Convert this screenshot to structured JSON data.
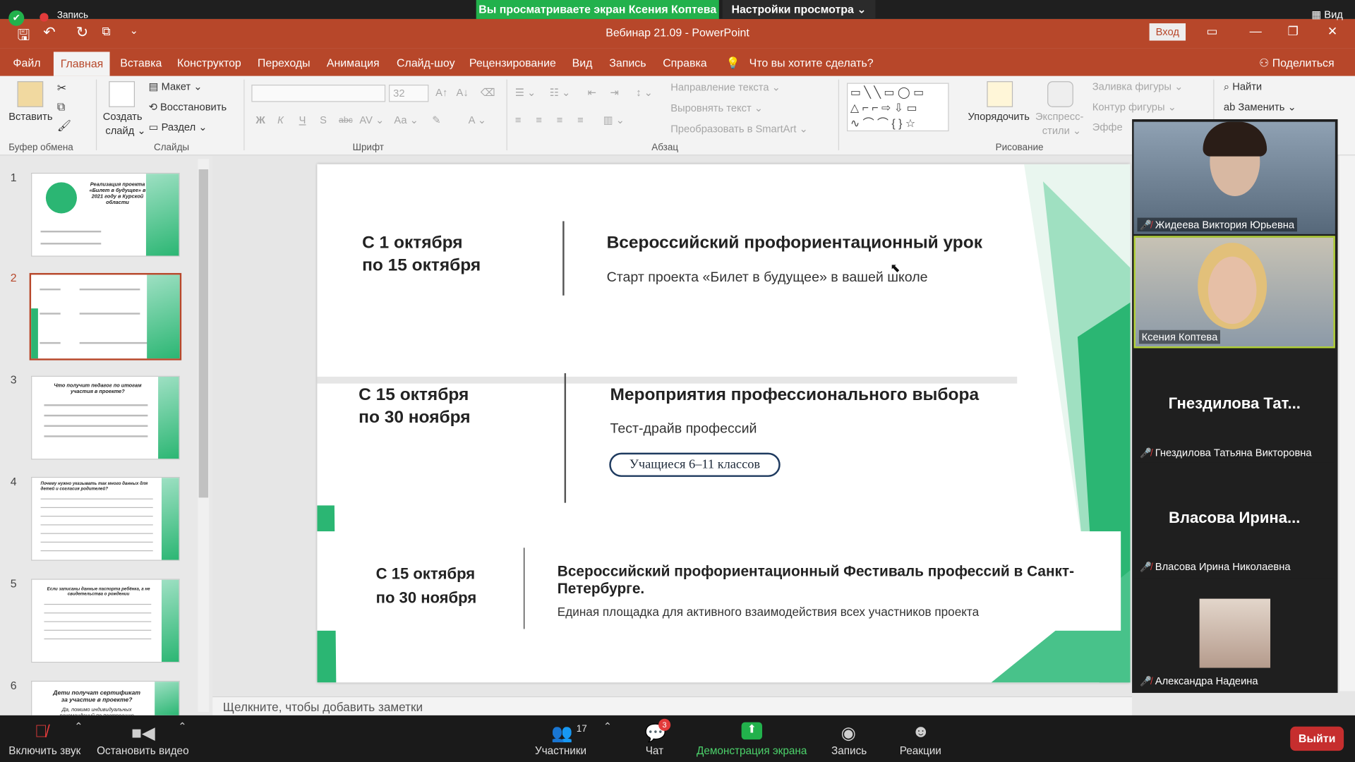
{
  "zoom_banner": {
    "sharing_text": "Вы просматриваете экран Ксения Коптева",
    "view_settings": "Настройки просмотра ⌄",
    "recording_label": "Запись",
    "view_label": "Вид"
  },
  "titlebar": {
    "document": "Вебинар 21.09  -  PowerPoint",
    "login": "Вход"
  },
  "menu": {
    "tabs": [
      "Файл",
      "Главная",
      "Вставка",
      "Конструктор",
      "Переходы",
      "Анимация",
      "Слайд-шоу",
      "Рецензирование",
      "Вид",
      "Запись",
      "Справка"
    ],
    "active_tab": "Главная",
    "tell_me": "Что вы хотите сделать?",
    "share": "Поделиться"
  },
  "ribbon": {
    "paste": "Вставить",
    "clipboard_group": "Буфер обмена",
    "new_slide_1": "Создать",
    "new_slide_2": "слайд ⌄",
    "layout": "Макет ⌄",
    "reset": "Восстановить",
    "section": "Раздел ⌄",
    "slides_group": "Слайды",
    "font_size": "32",
    "font_group": "Шрифт",
    "font_buttons": [
      "Ж",
      "К",
      "Ч",
      "S",
      "abc",
      "AV ⌄",
      "Аа ⌄",
      "A ⌄"
    ],
    "text_direction": "Направление текста ⌄",
    "align_text": "Выровнять текст ⌄",
    "smartart": "Преобразовать в SmartArt ⌄",
    "paragraph_group": "Абзац",
    "arrange": "Упорядочить",
    "express_styles_1": "Экспресс-",
    "express_styles_2": "стили ⌄",
    "shape_fill": "Заливка фигуры ⌄",
    "shape_outline": "Контур фигуры ⌄",
    "shape_effects": "Эффе",
    "drawing_group": "Рисование",
    "find": "Найти",
    "replace": "Заменить ⌄"
  },
  "thumbnails": {
    "numbers": [
      "1",
      "2",
      "3",
      "4",
      "5",
      "6"
    ],
    "selected": "2",
    "t1_title": "Реализация проекта «Билет в будущее» в 2021 году в Курской области",
    "t3_title": "Что получит педагог по итогам участия в проекте?",
    "t4_title": "Почему нужно указывать так много данных для детей и согласия родителей?",
    "t5_title": "Если записаны данные паспорта ребёнка, а не свидетельства о рождении",
    "t6_title": "Дети получат сертификат за участие в проекте?",
    "t6_body": "Да, помимо индивидуальных рекомендаций по построению"
  },
  "slide": {
    "row1": {
      "date_1": "С 1 октября",
      "date_2": "по 15 октября",
      "title": "Всероссийский профориентационный урок",
      "subtitle": "Старт проекта «Билет в будущее» в вашей школе"
    },
    "row2": {
      "date_1": "С 15 октября",
      "date_2": "по 30 ноября",
      "title": "Мероприятия профессионального выбора",
      "subtitle": "Тест-драйв профессий",
      "pill": "Учащиеся 6–11 классов"
    },
    "row3": {
      "date_1": "С 15 октября",
      "date_2": "по 30 ноября",
      "title": "Всероссийский профориентационный Фестиваль профессий в Санкт-Петербурге.",
      "subtitle": "Единая площадка для активного взаимодействия всех участников проекта"
    }
  },
  "notes_placeholder": "Щелкните, чтобы добавить заметки",
  "participants": [
    {
      "name": "Жидеева Виктория Юрьевна",
      "muted": true,
      "video": true
    },
    {
      "name": "Ксения Коптева",
      "muted": false,
      "video": true
    },
    {
      "big": "Гнездилова  Тат...",
      "name": "Гнездилова Татьяна Викторовна",
      "muted": true,
      "video": false
    },
    {
      "big": "Власова  Ирина...",
      "name": "Власова Ирина Николаевна",
      "muted": true,
      "video": false
    },
    {
      "name": "Александра Надеина",
      "muted": true,
      "video": true
    }
  ],
  "zoom_toolbar": {
    "unmute": "Включить звук",
    "start_video": "Остановить видео",
    "participants": "Участники",
    "participants_count": "17",
    "chat": "Чат",
    "chat_badge": "3",
    "share_screen": "Демонстрация экрана",
    "record": "Запись",
    "reactions": "Реакции",
    "leave": "Выйти"
  },
  "colors": {
    "ppt_accent": "#b7472a",
    "slide_green": "#2bb673",
    "zoom_share_green": "#22b14c",
    "leave_red": "#c62e2e"
  }
}
